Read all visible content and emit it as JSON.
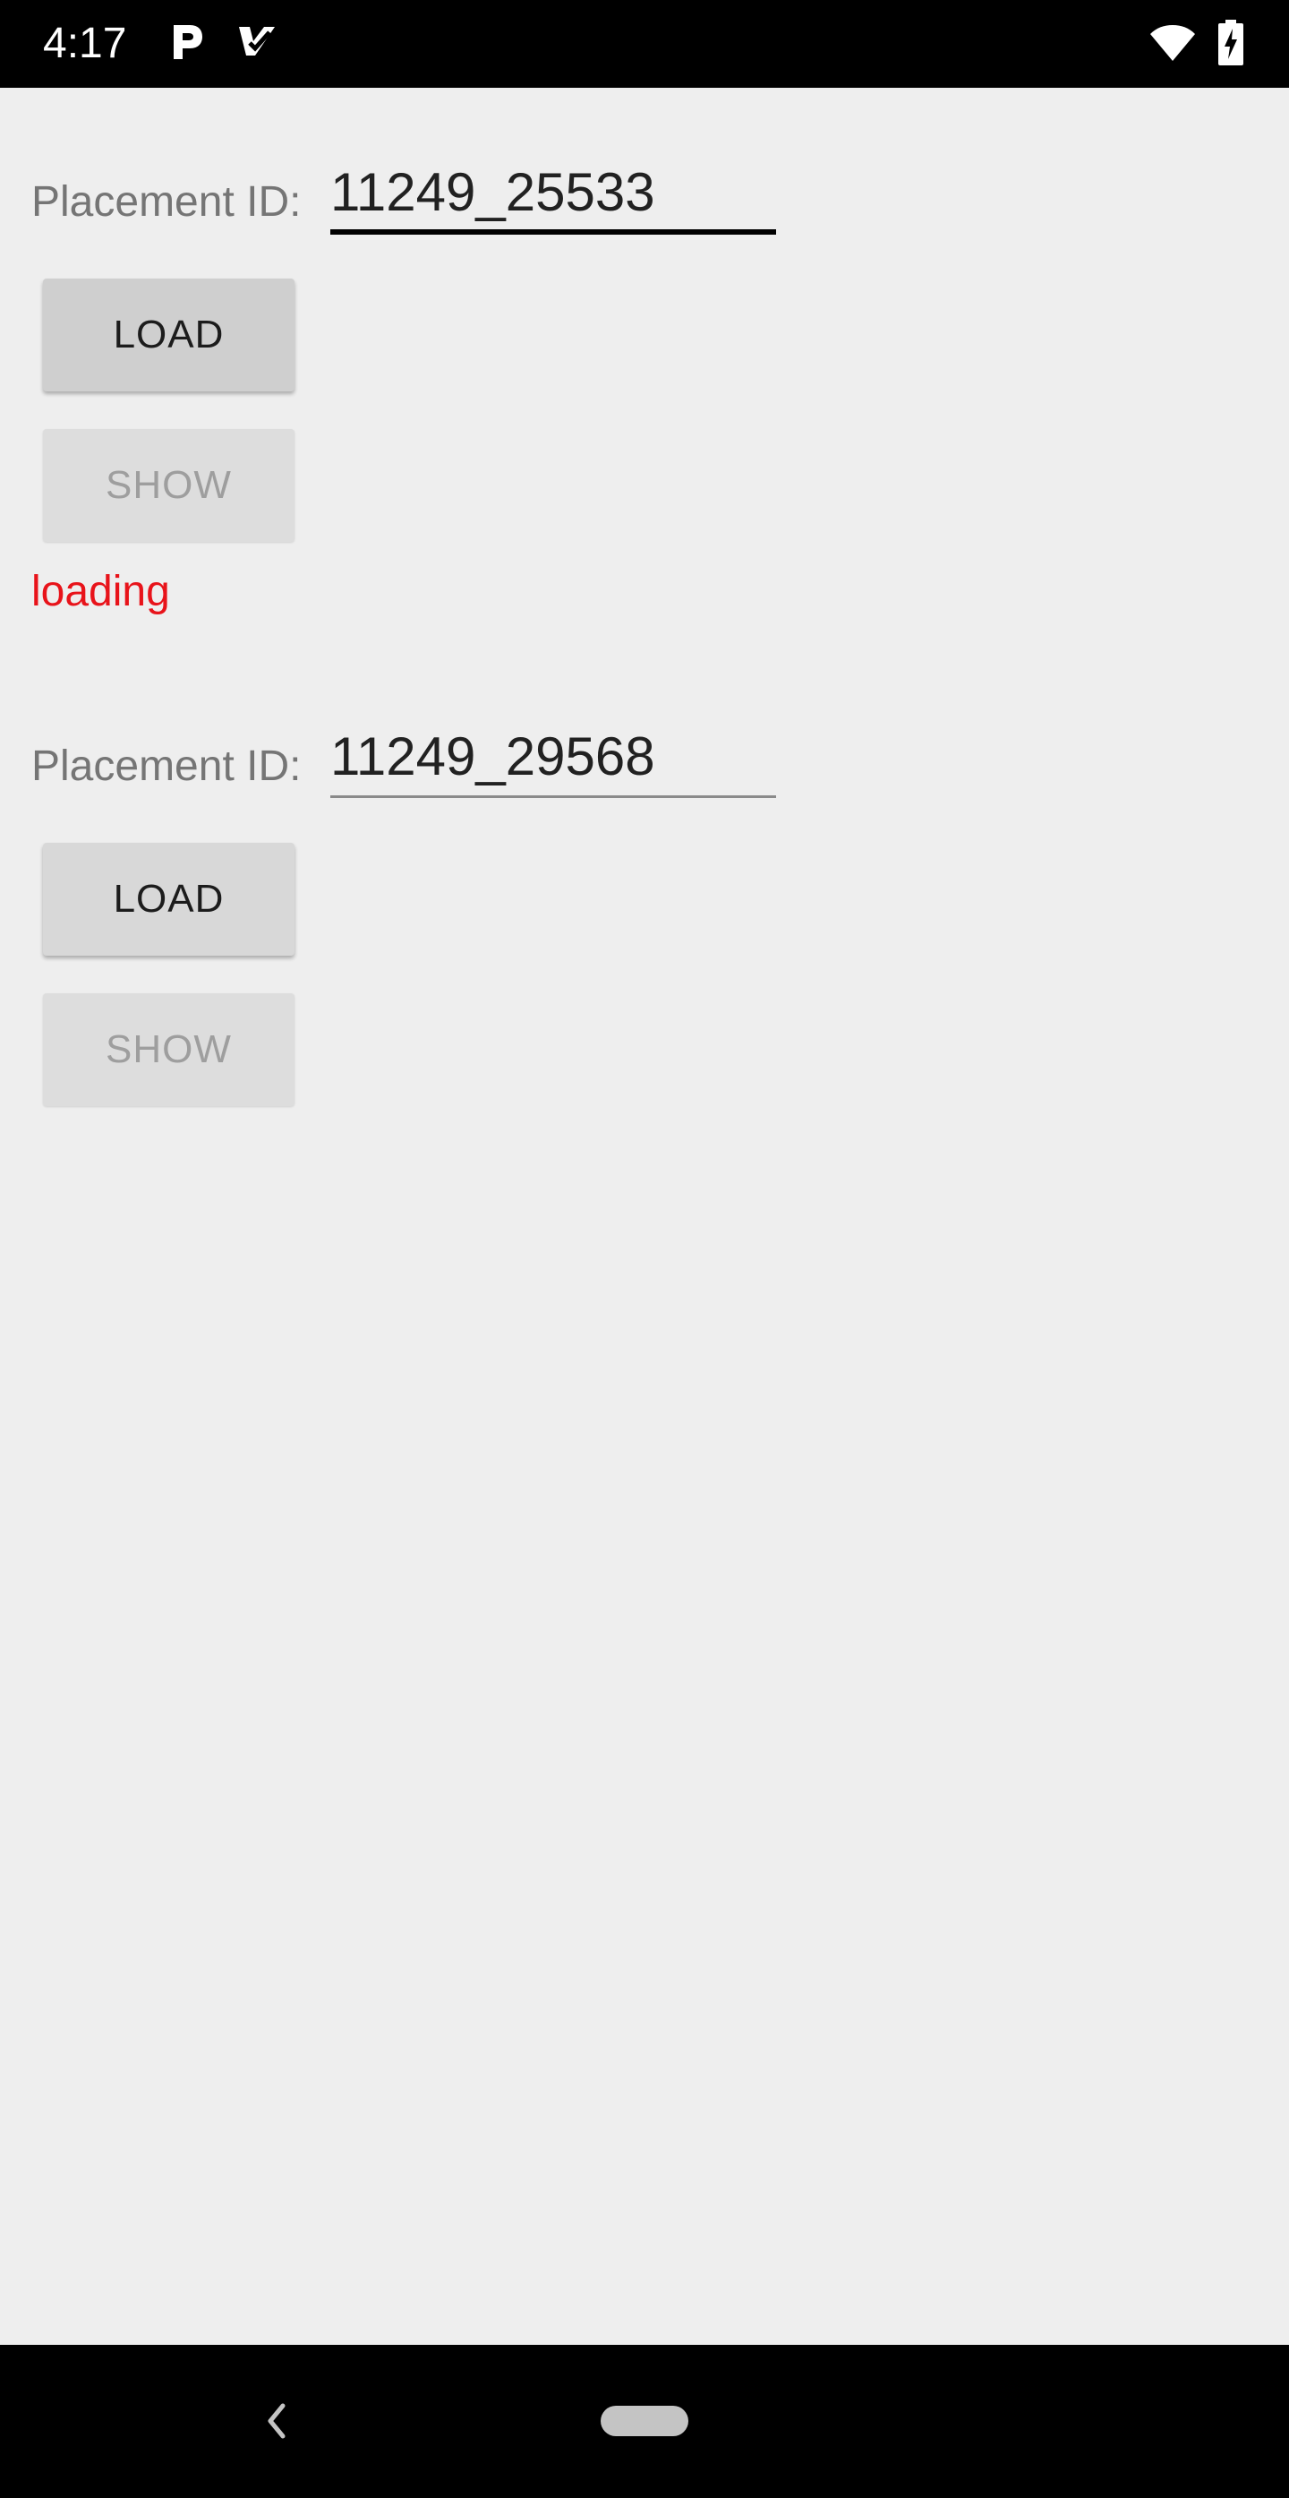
{
  "status_bar": {
    "time": "4:17",
    "icons": [
      "p-notification-icon",
      "checkmark-notification-icon",
      "wifi-icon",
      "battery-charging-icon"
    ]
  },
  "colors": {
    "loading_text": "#e8131a",
    "background": "#eeeeee"
  },
  "sections": [
    {
      "label": "Placement ID:",
      "placement_id": "11249_25533",
      "focused": true,
      "load_label": "LOAD",
      "show_label": "SHOW",
      "status": "loading"
    },
    {
      "label": "Placement ID:",
      "placement_id": "11249_29568",
      "focused": false,
      "load_label": "LOAD",
      "show_label": "SHOW",
      "status": ""
    }
  ],
  "nav_bar": {
    "icons": [
      "back-icon",
      "home-pill-icon"
    ]
  }
}
